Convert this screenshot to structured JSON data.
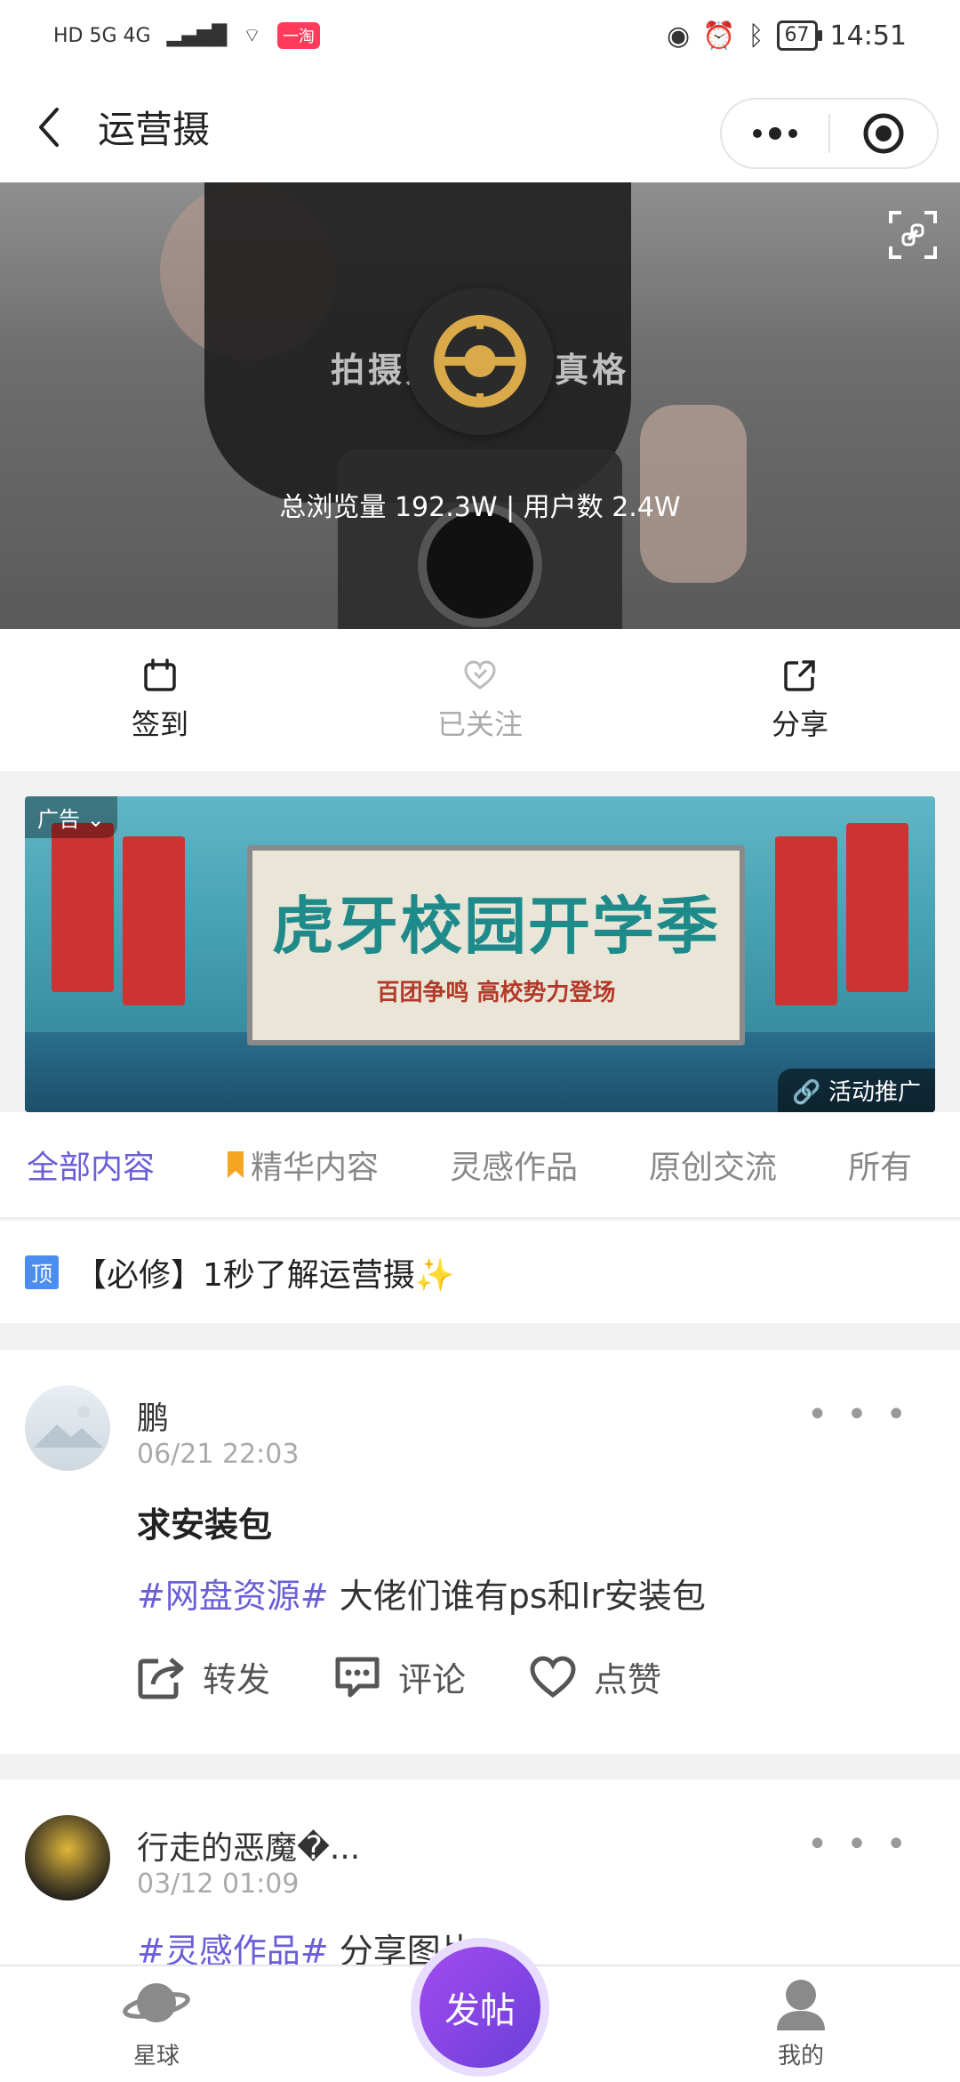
{
  "status_bar": {
    "network_left": "HD 5G 4G",
    "app_badge": "一淘",
    "battery": "67",
    "time": "14:51"
  },
  "nav": {
    "title": "运营摄"
  },
  "hero": {
    "bg_text": "拍摄无……次真格",
    "stats": "总浏览量 192.3W | 用户数 2.4W"
  },
  "actions": [
    {
      "label": "签到"
    },
    {
      "label": "已关注"
    },
    {
      "label": "分享"
    }
  ],
  "ad": {
    "tag": "广告",
    "title": "虎牙校园开学季",
    "subtitle": "百团争鸣 高校势力登场",
    "corner": "活动推广"
  },
  "tabs": [
    "全部内容",
    "精华内容",
    "灵感作品",
    "原创交流",
    "所有"
  ],
  "pinned": {
    "badge": "顶",
    "text": "【必修】1秒了解运营摄✨"
  },
  "posts": [
    {
      "name": "鹏",
      "time": "06/21 22:03",
      "title": "求安装包",
      "tag": "#网盘资源#",
      "body": " 大佬们谁有ps和lr安装包",
      "actions": [
        "转发",
        "评论",
        "点赞"
      ]
    },
    {
      "name": "行走的恶魔�...",
      "time": "03/12 01:09",
      "tag": "#灵感作品#",
      "body": " 分享图片"
    }
  ],
  "bottom_bar": {
    "planet": "星球",
    "post": "发帖",
    "mine": "我的"
  },
  "colors": {
    "accent": "#6a5fd6",
    "pin_badge": "#4b8ef0"
  }
}
